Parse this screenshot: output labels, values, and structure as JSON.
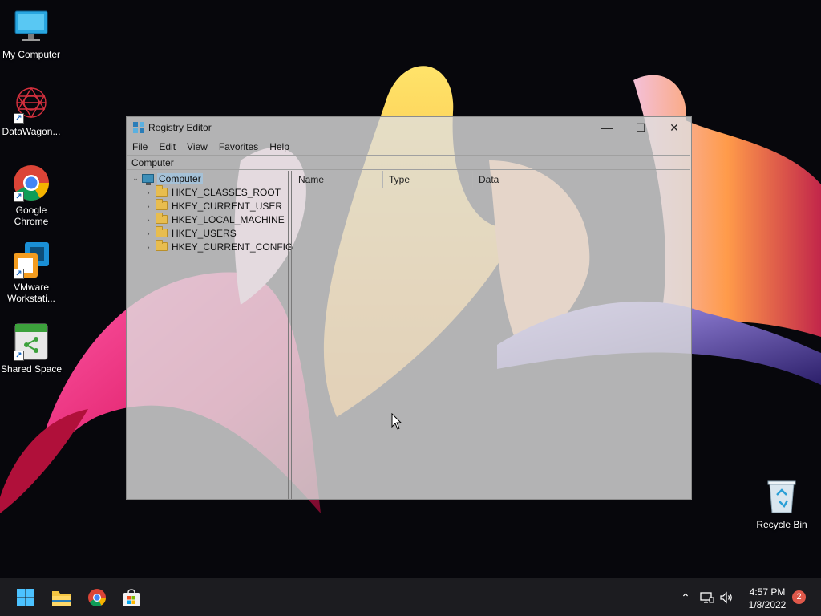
{
  "desktop": {
    "icons": [
      {
        "label": "My Computer",
        "icon": "monitor-icon"
      },
      {
        "label": "DataWagon...",
        "icon": "datawagon-icon"
      },
      {
        "label": "Google Chrome",
        "icon": "chrome-icon"
      },
      {
        "label": "VMware Workstati...",
        "icon": "vmware-icon"
      },
      {
        "label": "Shared Space",
        "icon": "shared-space-icon"
      }
    ],
    "recycle_bin": {
      "label": "Recycle Bin",
      "icon": "recycle-bin-icon"
    }
  },
  "registry_editor": {
    "title": "Registry Editor",
    "window_controls": {
      "minimize": "—",
      "maximize": "☐",
      "close": "✕"
    },
    "menu": [
      "File",
      "Edit",
      "View",
      "Favorites",
      "Help"
    ],
    "address": "Computer",
    "tree": {
      "root": "Computer",
      "root_chevron": "⌄",
      "keys": [
        "HKEY_CLASSES_ROOT",
        "HKEY_CURRENT_USER",
        "HKEY_LOCAL_MACHINE",
        "HKEY_USERS",
        "HKEY_CURRENT_CONFIG"
      ],
      "key_chevron": "›"
    },
    "columns": [
      "Name",
      "Type",
      "Data"
    ]
  },
  "taskbar": {
    "pinned": [
      "start-icon",
      "file-explorer-icon",
      "chrome-icon",
      "store-icon"
    ],
    "tray": {
      "chevron": "⌃",
      "speaker": "🔈"
    },
    "time": "4:57 PM",
    "date": "1/8/2022",
    "notification_count": "2"
  },
  "colors": {
    "taskbar_bg": "#1c1c20",
    "window_bg": "#dedede",
    "selection": "#a0c8e6",
    "badge": "#e0584a"
  }
}
